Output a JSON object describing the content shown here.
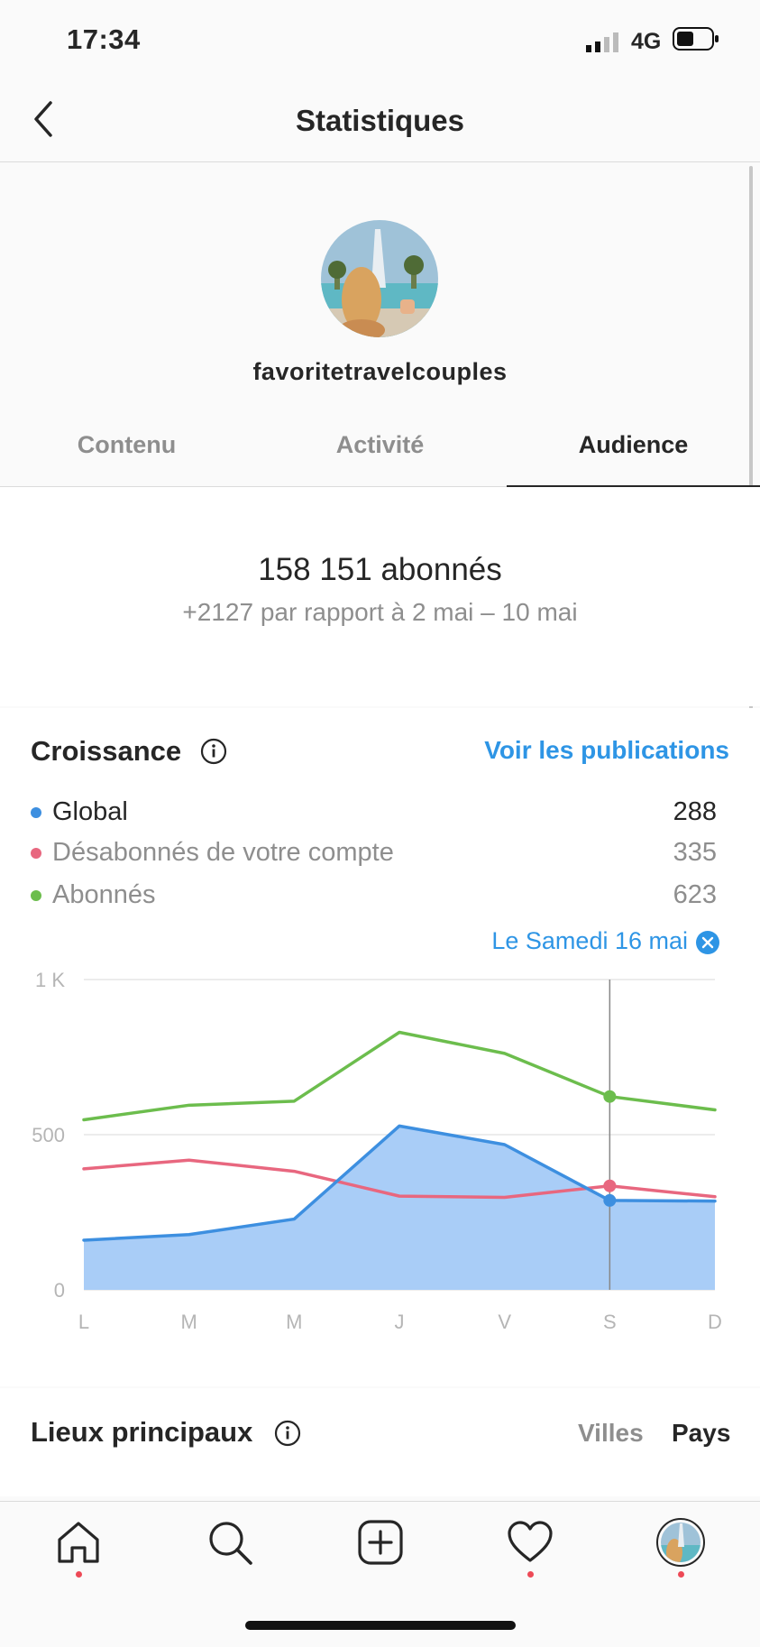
{
  "status_bar": {
    "time": "17:34",
    "network": "4G"
  },
  "header": {
    "title": "Statistiques",
    "back_icon": "chevron-left-icon"
  },
  "profile": {
    "username": "favoritetravelcouples"
  },
  "tabs": [
    {
      "label": "Contenu",
      "active": false
    },
    {
      "label": "Activité",
      "active": false
    },
    {
      "label": "Audience",
      "active": true
    }
  ],
  "audience": {
    "followers": "158 151 abonnés",
    "delta": "+2127 par rapport à 2 mai – 10 mai"
  },
  "growth": {
    "title": "Croissance",
    "see_posts": "Voir les publications",
    "selected_date": "Le Samedi 16 mai",
    "legend": [
      {
        "label": "Global",
        "value": "288",
        "color": "#3d8fe0"
      },
      {
        "label": "Désabonnés de votre compte",
        "value": "335",
        "color": "#e8677f"
      },
      {
        "label": "Abonnés",
        "value": "623",
        "color": "#6cbd4d"
      }
    ]
  },
  "chart_data": {
    "type": "line",
    "categories": [
      "L",
      "M",
      "M",
      "J",
      "V",
      "S",
      "D"
    ],
    "yticks": [
      "0",
      "500",
      "1 K"
    ],
    "ylim": [
      0,
      1000
    ],
    "grid": true,
    "selected_index": 5,
    "series": [
      {
        "name": "Global",
        "color": "#3d8fe0",
        "fill": "#a9cdf7",
        "values": [
          160,
          178,
          228,
          528,
          468,
          288,
          286
        ]
      },
      {
        "name": "Désabonnés de votre compte",
        "color": "#e8677f",
        "values": [
          390,
          418,
          382,
          302,
          298,
          335,
          300
        ]
      },
      {
        "name": "Abonnés",
        "color": "#6cbd4d",
        "values": [
          548,
          595,
          608,
          830,
          762,
          623,
          580
        ]
      }
    ]
  },
  "places": {
    "title": "Lieux principaux",
    "tab_cities": "Villes",
    "tab_countries": "Pays"
  },
  "bottom_nav": [
    "home-icon",
    "search-icon",
    "add-post-icon",
    "heart-icon",
    "profile-avatar"
  ]
}
